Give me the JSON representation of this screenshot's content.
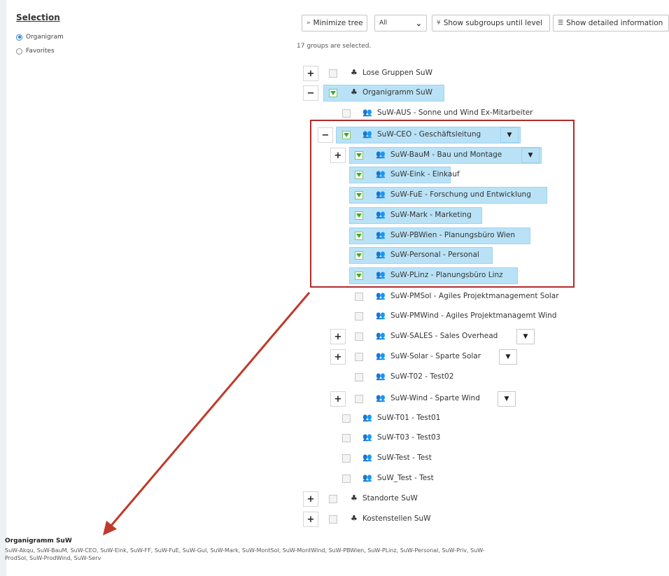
{
  "selection": {
    "title": "Selection",
    "options": [
      {
        "label": "Organigram",
        "selected": true
      },
      {
        "label": "Favorites",
        "selected": false
      }
    ]
  },
  "toolbar": {
    "minimize_label": "Minimize tree",
    "filter_value": "All",
    "subgroups_label": "Show subgroups until level",
    "detailed_label": "Show detailed information"
  },
  "status": {
    "selected_count": "17 groups are selected."
  },
  "tree": {
    "lose": "Lose Gruppen SuW",
    "organigramm": "Organigramm SuW",
    "aus": "SuW-AUS - Sonne und Wind Ex-Mitarbeiter",
    "ceo": "SuW-CEO - Geschäftsleitung",
    "baum": "SuW-BauM - Bau und Montage",
    "eink": "SuW-Eink - Einkauf",
    "fue": "SuW-FuE - Forschung und Entwicklung",
    "mark": "SuW-Mark - Marketing",
    "pbwien": "SuW-PBWien - Planungsbüro Wien",
    "personal": "SuW-Personal - Personal",
    "plinz": "SuW-PLinz - Planungsbüro Linz",
    "pmsol": "SuW-PMSol - Agiles Projektmanagement Solar",
    "pmwind": "SuW-PMWind - Agiles Projektmanagemt Wind",
    "sales": "SuW-SALES - Sales Overhead",
    "solar": "SuW-Solar - Sparte Solar",
    "t02": "SuW-T02 - Test02",
    "wind": "SuW-Wind - Sparte Wind",
    "t01": "SuW-T01 - Test01",
    "t03": "SuW-T03 - Test03",
    "test": "SuW-Test - Test",
    "test2": "SuW_Test - Test",
    "standorte": "Standorte SuW",
    "kosten": "Kostenstellen SuW"
  },
  "footer": {
    "title": "Organigramm SuW",
    "groups": "SuW-Akqu, SuW-BauM, SuW-CEO, SuW-Eink, SuW-FF, SuW-FuE, SuW-GuI, SuW-Mark, SuW-MontSol, SuW-MontWind, SuW-PBWien, SuW-PLinz, SuW-Personal, SuW-Priv, SuW-ProdSol, SuW-ProdWind, SuW-Serv"
  },
  "icons": {
    "structure": "sitemap-icon",
    "group": "users-icon",
    "dropdown": "caret-down-icon"
  },
  "colors": {
    "highlight": "#b9e2f7",
    "check": "#3aab26",
    "annotation": "#b22a2a"
  }
}
